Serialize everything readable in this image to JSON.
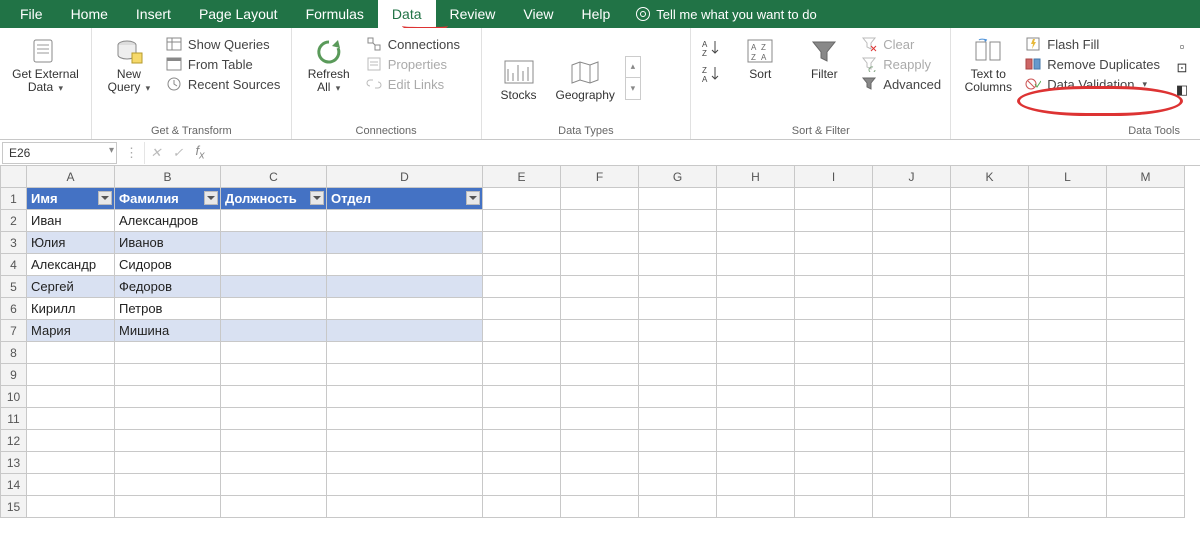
{
  "tabs": [
    "File",
    "Home",
    "Insert",
    "Page Layout",
    "Formulas",
    "Data",
    "Review",
    "View",
    "Help"
  ],
  "activeTab": "Data",
  "tellMe": "Tell me what you want to do",
  "ribbon": {
    "getExternal": {
      "label": "Get External\nData",
      "chevron": "▾"
    },
    "getTransform": {
      "newQuery": "New\nQuery",
      "items": [
        "Show Queries",
        "From Table",
        "Recent Sources"
      ],
      "group": "Get & Transform"
    },
    "connections": {
      "refresh": "Refresh\nAll",
      "items": [
        "Connections",
        "Properties",
        "Edit Links"
      ],
      "group": "Connections"
    },
    "dataTypes": {
      "stocks": "Stocks",
      "geo": "Geography",
      "group": "Data Types"
    },
    "sortFilter": {
      "sort": "Sort",
      "filter": "Filter",
      "items": [
        "Clear",
        "Reapply",
        "Advanced"
      ],
      "group": "Sort & Filter"
    },
    "dataTools": {
      "textToCols": "Text to\nColumns",
      "items": [
        "Flash Fill",
        "Remove Duplicates",
        "Data Validation"
      ],
      "group": "Data Tools"
    }
  },
  "nameBox": "E26",
  "columns": [
    "A",
    "B",
    "C",
    "D",
    "E",
    "F",
    "G",
    "H",
    "I",
    "J",
    "K",
    "L",
    "M"
  ],
  "tableHeaders": [
    "Имя",
    "Фамилия",
    "Должность",
    "Отдел"
  ],
  "tableRows": [
    [
      "Иван",
      "Александров",
      "",
      ""
    ],
    [
      "Юлия",
      "Иванов",
      "",
      ""
    ],
    [
      "Александр",
      "Сидоров",
      "",
      ""
    ],
    [
      "Сергей",
      "Федоров",
      "",
      ""
    ],
    [
      "Кирилл",
      "Петров",
      "",
      ""
    ],
    [
      "Мария",
      "Мишина",
      "",
      ""
    ]
  ],
  "blankRowCount": 8,
  "rowStart": 1
}
